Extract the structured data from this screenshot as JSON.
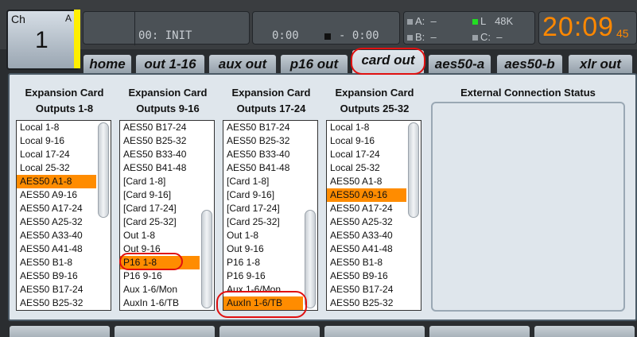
{
  "channel": {
    "label": "Ch",
    "badge": "A",
    "number": "1"
  },
  "scene": {
    "text": "00: INIT"
  },
  "transport": {
    "elapsed": "0:00",
    "remaining": "- 0:00"
  },
  "sync": {
    "a_label": "A:",
    "a_val": "–",
    "b_label": "B:",
    "b_val": "–",
    "l_label": "L",
    "l_val": "48K",
    "c_label": "C:",
    "c_val": "–"
  },
  "clock": {
    "time": "20:09",
    "seconds": "45"
  },
  "tabs": [
    {
      "label": "home",
      "active": false
    },
    {
      "label": "out 1-16",
      "active": false
    },
    {
      "label": "aux out",
      "active": false
    },
    {
      "label": "p16 out",
      "active": false
    },
    {
      "label": "card out",
      "active": true
    },
    {
      "label": "aes50-a",
      "active": false
    },
    {
      "label": "aes50-b",
      "active": false
    },
    {
      "label": "xlr out",
      "active": false
    }
  ],
  "columns": [
    {
      "title_line1": "Expansion Card",
      "title_line2": "Outputs 1-8",
      "items": [
        "Local 1-8",
        "Local 9-16",
        "Local 17-24",
        "Local 25-32",
        "AES50 A1-8",
        "AES50 A9-16",
        "AES50 A17-24",
        "AES50 A25-32",
        "AES50 A33-40",
        "AES50 A41-48",
        "AES50 B1-8",
        "AES50 B9-16",
        "AES50 B17-24",
        "AES50 B25-32"
      ],
      "selected": 4
    },
    {
      "title_line1": "Expansion Card",
      "title_line2": "Outputs 9-16",
      "items": [
        "AES50 B17-24",
        "AES50 B25-32",
        "AES50 B33-40",
        "AES50 B41-48",
        "[Card 1-8]",
        "[Card 9-16]",
        "[Card 17-24]",
        "[Card 25-32]",
        "Out 1-8",
        "Out 9-16",
        "P16 1-8",
        "P16 9-16",
        "Aux 1-6/Mon",
        "AuxIn 1-6/TB"
      ],
      "selected": 10
    },
    {
      "title_line1": "Expansion Card",
      "title_line2": "Outputs 17-24",
      "items": [
        "AES50 B17-24",
        "AES50 B25-32",
        "AES50 B33-40",
        "AES50 B41-48",
        "[Card 1-8]",
        "[Card 9-16]",
        "[Card 17-24]",
        "[Card 25-32]",
        "Out 1-8",
        "Out 9-16",
        "P16 1-8",
        "P16 9-16",
        "Aux 1-6/Mon",
        "AuxIn 1-6/TB"
      ],
      "selected": 13
    },
    {
      "title_line1": "Expansion Card",
      "title_line2": "Outputs 25-32",
      "items": [
        "Local 1-8",
        "Local 9-16",
        "Local 17-24",
        "Local 25-32",
        "AES50 A1-8",
        "AES50 A9-16",
        "AES50 A17-24",
        "AES50 A25-32",
        "AES50 A33-40",
        "AES50 A41-48",
        "AES50 B1-8",
        "AES50 B9-16",
        "AES50 B17-24",
        "AES50 B25-32"
      ],
      "selected": 5
    }
  ],
  "external": {
    "title": "External Connection Status"
  },
  "colors": {
    "selected": "#ff8c00",
    "clock": "#ff8800",
    "annotation": "#e01010",
    "channel_marker": "#ffee00"
  }
}
